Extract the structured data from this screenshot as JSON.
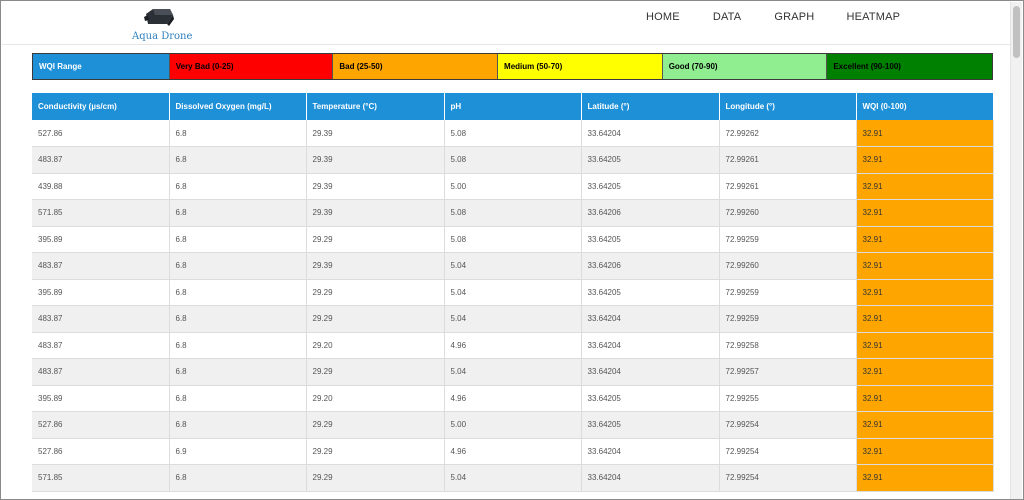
{
  "brand": {
    "name": "Aqua Drone"
  },
  "nav": {
    "home": "HOME",
    "data": "DATA",
    "graph": "GRAPH",
    "heatmap": "HEATMAP"
  },
  "legend": {
    "items": [
      {
        "label": "WQI Range",
        "color": "#1e90d8",
        "text_color": "#ffffff"
      },
      {
        "label": "Very Bad (0-25)",
        "color": "#ff0000",
        "text_color": "#000000"
      },
      {
        "label": "Bad (25-50)",
        "color": "#ffa500",
        "text_color": "#000000"
      },
      {
        "label": "Medium (50-70)",
        "color": "#ffff00",
        "text_color": "#000000"
      },
      {
        "label": "Good (70-90)",
        "color": "#90ee90",
        "text_color": "#000000"
      },
      {
        "label": "Excellent (90-100)",
        "color": "#008000",
        "text_color": "#000000"
      }
    ]
  },
  "table": {
    "headers": [
      "Conductivity (µs/cm)",
      "Dissolved Oxygen (mg/L)",
      "Temperature (°C)",
      "pH",
      "Latitude (°)",
      "Longitude (°)",
      "WQI (0-100)"
    ],
    "rows": [
      [
        "527.86",
        "6.8",
        "29.39",
        "5.08",
        "33.64204",
        "72.99262",
        "32.91"
      ],
      [
        "483.87",
        "6.8",
        "29.39",
        "5.08",
        "33.64205",
        "72.99261",
        "32.91"
      ],
      [
        "439.88",
        "6.8",
        "29.39",
        "5.00",
        "33.64205",
        "72.99261",
        "32.91"
      ],
      [
        "571.85",
        "6.8",
        "29.39",
        "5.08",
        "33.64206",
        "72.99260",
        "32.91"
      ],
      [
        "395.89",
        "6.8",
        "29.29",
        "5.08",
        "33.64205",
        "72.99259",
        "32.91"
      ],
      [
        "483.87",
        "6.8",
        "29.39",
        "5.04",
        "33.64206",
        "72.99260",
        "32.91"
      ],
      [
        "395.89",
        "6.8",
        "29.29",
        "5.04",
        "33.64205",
        "72.99259",
        "32.91"
      ],
      [
        "483.87",
        "6.8",
        "29.29",
        "5.04",
        "33.64204",
        "72.99259",
        "32.91"
      ],
      [
        "483.87",
        "6.8",
        "29.20",
        "4.96",
        "33.64204",
        "72.99258",
        "32.91"
      ],
      [
        "483.87",
        "6.8",
        "29.29",
        "5.04",
        "33.64204",
        "72.99257",
        "32.91"
      ],
      [
        "395.89",
        "6.8",
        "29.20",
        "4.96",
        "33.64205",
        "72.99255",
        "32.91"
      ],
      [
        "527.86",
        "6.8",
        "29.29",
        "5.00",
        "33.64205",
        "72.99254",
        "32.91"
      ],
      [
        "527.86",
        "6.9",
        "29.29",
        "4.96",
        "33.64204",
        "72.99254",
        "32.91"
      ],
      [
        "571.85",
        "6.8",
        "29.29",
        "5.04",
        "33.64204",
        "72.99254",
        "32.91"
      ]
    ]
  },
  "colors": {
    "header_bg": "#1e90d8",
    "wqi_cell": "#ffa500",
    "row_alt": "#f0f0f0"
  }
}
